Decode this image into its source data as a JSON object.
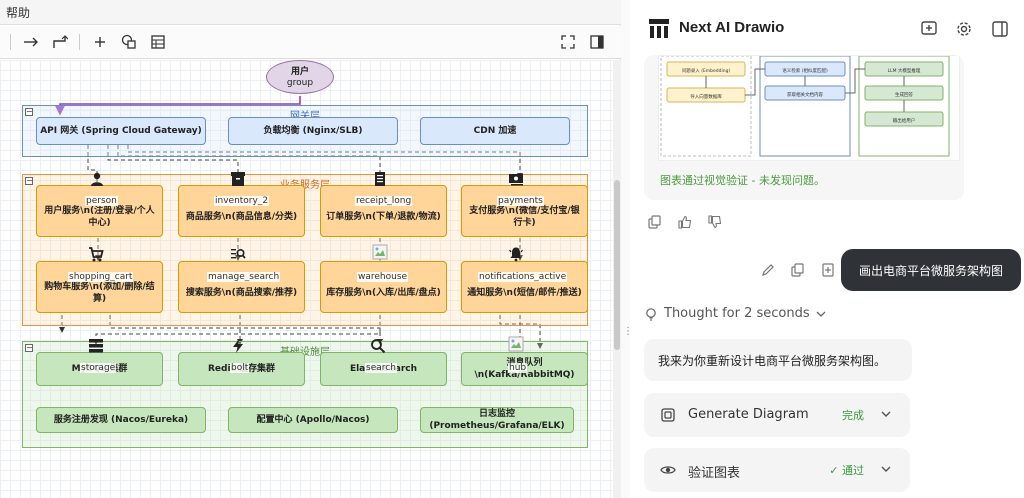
{
  "menubar": {
    "help_label": "帮助"
  },
  "diagram": {
    "user": {
      "title": "用户",
      "subtitle": "group"
    },
    "layers": {
      "gateway": "网关层",
      "business": "业务服务层",
      "infra": "基础设施层"
    },
    "gateway_nodes": [
      "API 网关 (Spring Cloud Gateway)",
      "负载均衡 (Nginx/SLB)",
      "CDN 加速"
    ],
    "business_nodes": [
      {
        "icon_label": "person",
        "text": "用户服务\\n(注册/登录/个人中心)"
      },
      {
        "icon_label": "inventory_2",
        "text": "商品服务\\n(商品信息/分类)"
      },
      {
        "icon_label": "receipt_long",
        "text": "订单服务\\n(下单/退款/物流)"
      },
      {
        "icon_label": "payments",
        "text": "支付服务\\n(微信/支付宝/银行卡)"
      },
      {
        "icon_label": "shopping_cart",
        "text": "购物车服务\\n(添加/删除/结算)"
      },
      {
        "icon_label": "manage_search",
        "text": "搜索服务\\n(商品搜索/推荐)"
      },
      {
        "icon_label": "warehouse",
        "text": "库存服务\\n(入库/出库/盘点)"
      },
      {
        "icon_label": "notifications_active",
        "text": "通知服务\\n(短信/邮件/推送)"
      }
    ],
    "infra_nodes": [
      {
        "icon_label": "storage",
        "text": "MySQL 集群"
      },
      {
        "icon_label": "bolt",
        "text": "Redis 缓存集群"
      },
      {
        "icon_label": "search",
        "text": "Elasticsearch"
      },
      {
        "icon_label": "hub",
        "text": "消息队列\\n(Kafka/RabbitMQ)"
      }
    ],
    "infra_bottom": [
      "服务注册发现 (Nacos/Eureka)",
      "配置中心 (Apollo/Nacos)",
      "日志监控 (Prometheus/Grafana/ELK)"
    ]
  },
  "chat": {
    "app_title": "Next AI Drawio",
    "preview": {
      "verify_text": "图表通过视觉验证 - 未发现问题。",
      "mini_labels": [
        "问题录入 (Embedding)",
        "导入向量数据库",
        "语义检索 (相似度匹配)",
        "获取相关文档内容",
        "LLM 大模型推理",
        "生成回答",
        "输出给用户"
      ]
    },
    "user_message": "画出电商平台微服务架构图",
    "thought_label": "Thought for 2 seconds",
    "assistant_message": "我来为你重新设计电商平台微服务架构图。",
    "tools": [
      {
        "name": "Generate Diagram",
        "status": "完成"
      },
      {
        "name": "验证图表",
        "status": "✓ 通过"
      }
    ]
  },
  "colors": {
    "gateway_fill": "#dae8fc",
    "business_fill": "#ffd59a",
    "infra_fill": "#c6e6bd",
    "success_green": "#4a9b3e",
    "bubble_dark": "#2f3337"
  }
}
